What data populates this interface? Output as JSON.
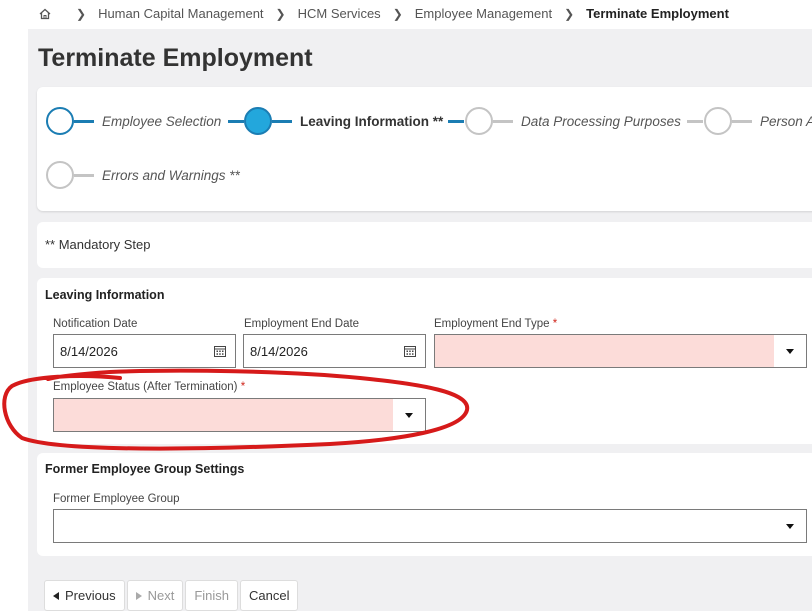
{
  "breadcrumb": {
    "items": [
      "Human Capital Management",
      "HCM Services",
      "Employee Management"
    ],
    "current": "Terminate Employment"
  },
  "page_title": "Terminate Employment",
  "train": {
    "steps": [
      {
        "label": "Employee Selection",
        "state": "visited"
      },
      {
        "label": "Leaving Information **",
        "state": "active"
      },
      {
        "label": "Data Processing Purposes",
        "state": "unvisited"
      },
      {
        "label": "Person A",
        "state": "unvisited"
      },
      {
        "label": "Errors and Warnings **",
        "state": "unvisited"
      }
    ]
  },
  "mandatory_note": "** Mandatory Step",
  "leaving_info": {
    "title": "Leaving Information",
    "notification_date": {
      "label": "Notification Date",
      "value": "8/14/2026"
    },
    "employment_end_date": {
      "label": "Employment End Date",
      "value": "8/14/2026"
    },
    "employment_end_type": {
      "label": "Employment End Type",
      "required_mark": "*",
      "value": ""
    },
    "employee_status": {
      "label": "Employee Status (After Termination)",
      "required_mark": "*",
      "value": ""
    }
  },
  "former_group": {
    "title": "Former Employee Group Settings",
    "field": {
      "label": "Former Employee Group",
      "value": ""
    }
  },
  "buttons": {
    "previous": "Previous",
    "next": "Next",
    "finish": "Finish",
    "cancel": "Cancel"
  },
  "colors": {
    "accent": "#1b7db3",
    "active_fill": "#23a7dc",
    "error_fill": "#fcdcd9",
    "annotation": "#d61a1a"
  }
}
